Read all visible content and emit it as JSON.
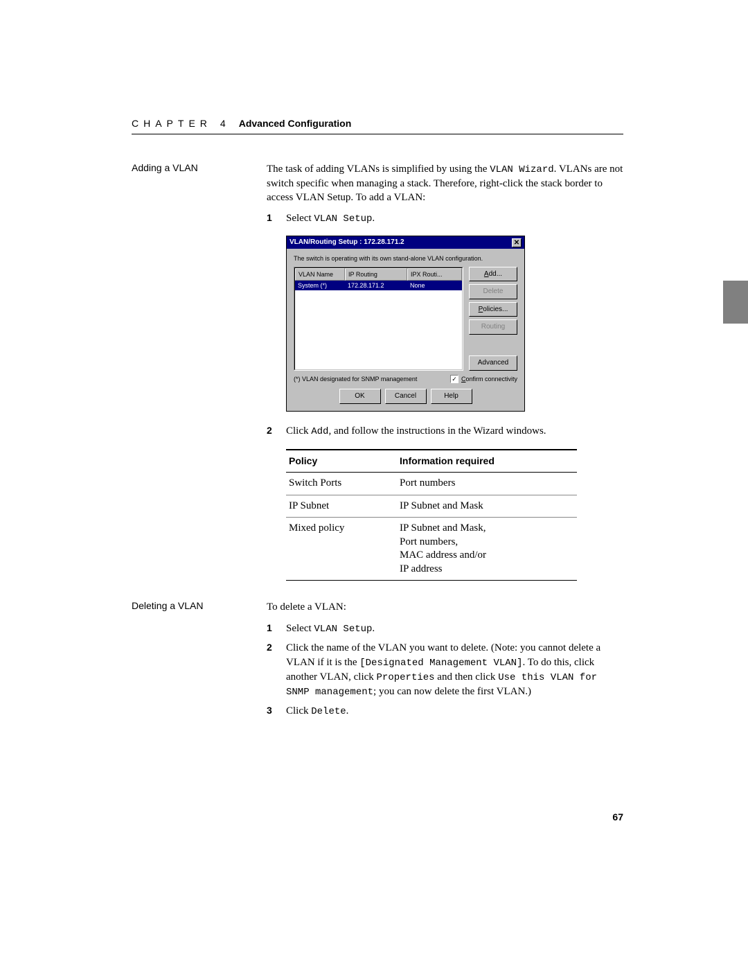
{
  "header": {
    "chapter_label": "CHAPTER",
    "chapter_num": "4",
    "chapter_title": "Advanced Configuration"
  },
  "add_section": {
    "side_label": "Adding a VLAN",
    "intro_1": "The task of adding VLANs is simplified by using the ",
    "intro_mono": "VLAN Wizard",
    "intro_2": ". VLANs are not switch specific when managing a stack. Therefore, right-click the stack border to access VLAN Setup. To add a VLAN:",
    "step1_num": "1",
    "step1_a": "Select ",
    "step1_mono": "VLAN Setup",
    "step1_b": ".",
    "step2_num": "2",
    "step2_a": "Click ",
    "step2_mono": "Add",
    "step2_b": ", and follow the instructions in the Wizard windows."
  },
  "dialog": {
    "title": "VLAN/Routing Setup : 172.28.171.2",
    "msg": "The switch is operating with its own stand-alone VLAN configuration.",
    "col1": "VLAN Name",
    "col2": "IP Routing",
    "col3": "IPX Routi...",
    "row_name": "System (*)",
    "row_ip": "172.28.171.2",
    "row_ipx": "None",
    "btn_add": "Add...",
    "btn_delete": "Delete",
    "btn_policies": "Policies...",
    "btn_routing": "Routing",
    "btn_advanced": "Advanced",
    "foot_note": "(*) VLAN designated for SNMP management",
    "chk_label": "Confirm connectivity",
    "ok": "OK",
    "cancel": "Cancel",
    "help": "Help"
  },
  "policy_table": {
    "h1": "Policy",
    "h2": "Information required",
    "r1c1": "Switch Ports",
    "r1c2": "Port numbers",
    "r2c1": "IP Subnet",
    "r2c2": "IP Subnet and Mask",
    "r3c1": "Mixed policy",
    "r3c2": "IP Subnet and Mask,\nPort numbers,\nMAC address and/or\nIP address"
  },
  "del_section": {
    "side_label": "Deleting a VLAN",
    "intro": "To delete a VLAN:",
    "step1_num": "1",
    "step1_a": "Select ",
    "step1_mono": "VLAN Setup",
    "step1_b": ".",
    "step2_num": "2",
    "step2_a": "Click the name of the VLAN you want to delete. (Note: you cannot delete a VLAN if it is the ",
    "step2_m1": "[Designated Management VLAN]",
    "step2_b": ". To do this, click another VLAN, click ",
    "step2_m2": "Properties",
    "step2_c": " and then click ",
    "step2_m3": "Use this VLAN for SNMP management",
    "step2_d": "; you can now delete the first VLAN.)",
    "step3_num": "3",
    "step3_a": "Click ",
    "step3_mono": "Delete",
    "step3_b": "."
  },
  "page_num": "67"
}
